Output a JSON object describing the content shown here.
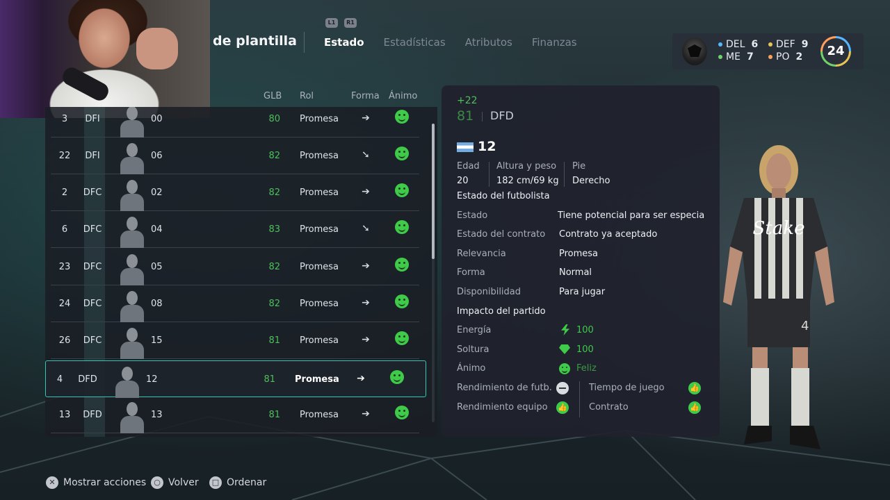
{
  "header": {
    "title_partial": "de plantilla",
    "shoulder_left": "L1",
    "shoulder_right": "R1",
    "tabs": [
      {
        "label": "Estado",
        "active": true
      },
      {
        "label": "Estadísticas",
        "active": false
      },
      {
        "label": "Atributos",
        "active": false
      },
      {
        "label": "Finanzas",
        "active": false
      }
    ]
  },
  "summary": {
    "positions": [
      {
        "label": "DEL",
        "count": "6",
        "color": "#58b8ff"
      },
      {
        "label": "DEF",
        "count": "9",
        "color": "#e7c453"
      },
      {
        "label": "ME",
        "count": "7",
        "color": "#6fd36c"
      },
      {
        "label": "PO",
        "count": "2",
        "color": "#ff9f5a"
      }
    ],
    "total": "24"
  },
  "list": {
    "columns": {
      "glb": "GLB",
      "rol": "Rol",
      "forma": "Forma",
      "animo": "Ánimo"
    },
    "rows": [
      {
        "num": "3",
        "pos": "DFI",
        "name": "00",
        "glb": "80",
        "rol": "Promesa",
        "forma": "right-arrow-icon"
      },
      {
        "num": "22",
        "pos": "DFI",
        "name": "06",
        "glb": "82",
        "rol": "Promesa",
        "forma": "down-left-arrow-icon"
      },
      {
        "num": "2",
        "pos": "DFC",
        "name": "02",
        "glb": "82",
        "rol": "Promesa",
        "forma": "right-arrow-icon"
      },
      {
        "num": "6",
        "pos": "DFC",
        "name": "04",
        "glb": "83",
        "rol": "Promesa",
        "forma": "down-left-arrow-icon"
      },
      {
        "num": "23",
        "pos": "DFC",
        "name": "05",
        "glb": "82",
        "rol": "Promesa",
        "forma": "right-arrow-icon"
      },
      {
        "num": "24",
        "pos": "DFC",
        "name": "08",
        "glb": "82",
        "rol": "Promesa",
        "forma": "right-arrow-icon"
      },
      {
        "num": "26",
        "pos": "DFC",
        "name": "15",
        "glb": "81",
        "rol": "Promesa",
        "forma": "right-arrow-icon"
      },
      {
        "num": "4",
        "pos": "DFD",
        "name": "12",
        "glb": "81",
        "rol": "Promesa",
        "forma": "right-arrow-icon",
        "selected": true
      },
      {
        "num": "13",
        "pos": "DFD",
        "name": "13",
        "glb": "81",
        "rol": "Promesa",
        "forma": "right-arrow-icon"
      }
    ]
  },
  "detail": {
    "change": "+22",
    "overall": "81",
    "position": "DFD",
    "name": "12",
    "age_label": "Edad",
    "age": "20",
    "height_weight_label": "Altura y peso",
    "height_weight": "182 cm/69 kg",
    "foot_label": "Pie",
    "foot": "Derecho",
    "status_heading": "Estado del futbolista",
    "status_rows": [
      {
        "label": "Estado",
        "value": "Tiene potencial para ser especia"
      },
      {
        "label": "Estado del contrato",
        "value": "Contrato ya aceptado"
      },
      {
        "label": "Relevancia",
        "value": "Promesa"
      },
      {
        "label": "Forma",
        "value": "Normal"
      },
      {
        "label": "Disponibilidad",
        "value": "Para jugar"
      }
    ],
    "impact_heading": "Impacto del partido",
    "energy_label": "Energía",
    "energy": "100",
    "sharpness_label": "Soltura",
    "sharpness": "100",
    "morale_label": "Ánimo",
    "morale": "Feliz",
    "perf_label": "Rendimiento de futb.",
    "team_perf_label": "Rendimiento equipo",
    "playtime_label": "Tiempo de juego",
    "contract_label": "Contrato",
    "accent_green": "#3fca4a"
  },
  "player_model": {
    "sponsor": "Stake",
    "shirt_number": "4"
  },
  "footer": {
    "actions": [
      {
        "glyph": "✕",
        "icon": "cross-button-icon",
        "label": "Mostrar acciones"
      },
      {
        "glyph": "○",
        "icon": "circle-button-icon",
        "label": "Volver"
      },
      {
        "glyph": "□",
        "icon": "square-button-icon",
        "label": "Ordenar"
      }
    ]
  }
}
